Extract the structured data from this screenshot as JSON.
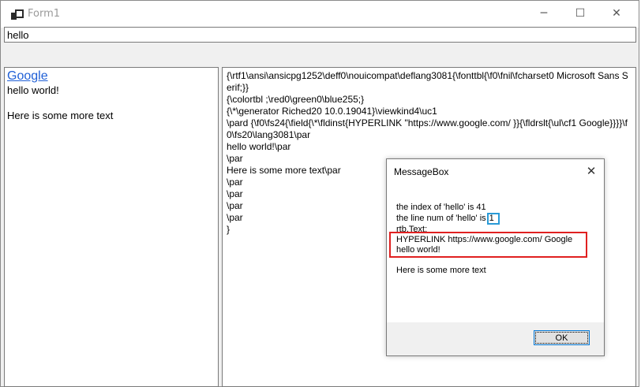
{
  "window": {
    "title": "Form1",
    "controls": {
      "minimize": "─",
      "maximize": "☐",
      "close": "✕"
    }
  },
  "top_input": {
    "value": "hello"
  },
  "left_rtb": {
    "link_text": "Google",
    "lines": [
      "hello world!",
      "",
      "Here is some more text"
    ]
  },
  "right_rtb": {
    "text": "{\\rtf1\\ansi\\ansicpg1252\\deff0\\nouicompat\\deflang3081{\\fonttbl{\\f0\\fnil\\fcharset0 Microsoft Sans Serif;}}\n{\\colortbl ;\\red0\\green0\\blue255;}\n{\\*\\generator Riched20 10.0.19041}\\viewkind4\\uc1\n\\pard {\\f0\\fs24{\\field{\\*\\fldinst{HYPERLINK \"https://www.google.com/ }}{\\fldrslt{\\ul\\cf1 Google}}}}\\f0\\fs20\\lang3081\\par\nhello world!\\par\n\\par\nHere is some more text\\par\n\\par\n\\par\n\\par\n\\par\n}"
  },
  "messagebox": {
    "title": "MessageBox",
    "close": "✕",
    "line_index": "the index of 'hello' is 41",
    "line_num_prefix": "the line num of 'hello' is",
    "line_num_value": "1",
    "line_rtb": "rtb.Text:",
    "line_hyperlink": "HYPERLINK https://www.google.com/ Google",
    "line_hello": "hello world!",
    "line_more": "Here is some more text",
    "ok_label": "OK"
  }
}
